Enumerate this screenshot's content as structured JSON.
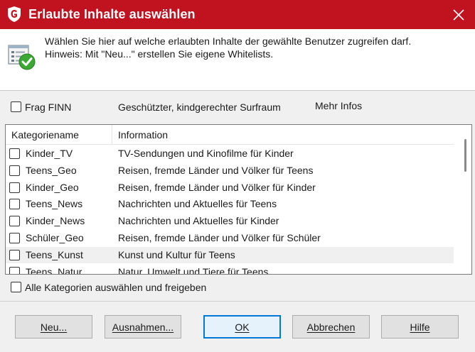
{
  "window": {
    "title": "Erlaubte Inhalte auswählen"
  },
  "header": {
    "line1": "Wählen Sie hier auf welche erlaubten Inhalte der gewählte Benutzer zugreifen darf.",
    "line2": "Hinweis: Mit \"Neu...\" erstellen Sie eigene Whitelists."
  },
  "finn": {
    "checkbox_label": "Frag FINN",
    "checked": false,
    "description": "Geschützter, kindgerechter Surfraum",
    "more_info": "Mehr Infos"
  },
  "list": {
    "columns": [
      "Kategoriename",
      "Information"
    ],
    "rows": [
      {
        "name": "Kinder_TV",
        "info": "TV-Sendungen und Kinofilme für Kinder",
        "checked": false
      },
      {
        "name": "Teens_Geo",
        "info": "Reisen, fremde Länder und Völker für Teens",
        "checked": false
      },
      {
        "name": "Kinder_Geo",
        "info": "Reisen, fremde Länder und Völker für Kinder",
        "checked": false
      },
      {
        "name": "Teens_News",
        "info": "Nachrichten und Aktuelles für Teens",
        "checked": false
      },
      {
        "name": "Kinder_News",
        "info": "Nachrichten und Aktuelles für Kinder",
        "checked": false
      },
      {
        "name": "Schüler_Geo",
        "info": "Reisen, fremde Länder und Völker für Schüler",
        "checked": false
      },
      {
        "name": "Teens_Kunst",
        "info": "Kunst und Kultur für Teens",
        "checked": false,
        "selected": true
      },
      {
        "name": "Teens_Natur",
        "info": "Natur, Umwelt und Tiere für Teens",
        "checked": false
      }
    ]
  },
  "select_all": {
    "label": "Alle Kategorien auswählen und freigeben",
    "checked": false
  },
  "buttons": {
    "new": "Neu...",
    "exceptions": "Ausnahmen...",
    "ok": "OK",
    "cancel": "Abbrechen",
    "help": "Hilfe"
  },
  "colors": {
    "titlebar": "#c1121f",
    "focus": "#0078d7"
  },
  "icons": {
    "title": "gdata-shield-logo",
    "header": "list-check-icon",
    "close": "close-icon"
  }
}
